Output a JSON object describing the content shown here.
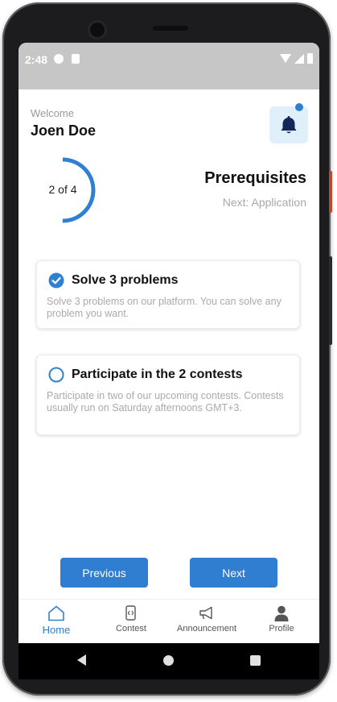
{
  "status_bar": {
    "time": "2:48"
  },
  "header": {
    "welcome": "Welcome",
    "username": "Joen Doe"
  },
  "progress": {
    "label": "2 of 4",
    "current": 2,
    "total": 4,
    "title": "Prerequisites",
    "next": "Next: Application"
  },
  "tasks": [
    {
      "title": "Solve 3 problems",
      "description": "Solve 3 problems on our platform. You can solve any problem you want.",
      "completed": true
    },
    {
      "title": "Participate in the 2 contests",
      "description": "Participate in two of our upcoming contests. Contests usually run on Saturday afternoons GMT+3.",
      "completed": false
    }
  ],
  "buttons": {
    "previous": "Previous",
    "next": "Next"
  },
  "bottom_nav": [
    {
      "label": "Home",
      "icon": "home-icon",
      "active": true
    },
    {
      "label": "Contest",
      "icon": "contest-icon",
      "active": false
    },
    {
      "label": "Announcement",
      "icon": "megaphone-icon",
      "active": false
    },
    {
      "label": "Profile",
      "icon": "profile-icon",
      "active": false
    }
  ],
  "colors": {
    "accent": "#2f80d1",
    "bell_bg": "#dff0fb",
    "bell_icon": "#12285a",
    "muted_text": "#aaaaaa"
  }
}
